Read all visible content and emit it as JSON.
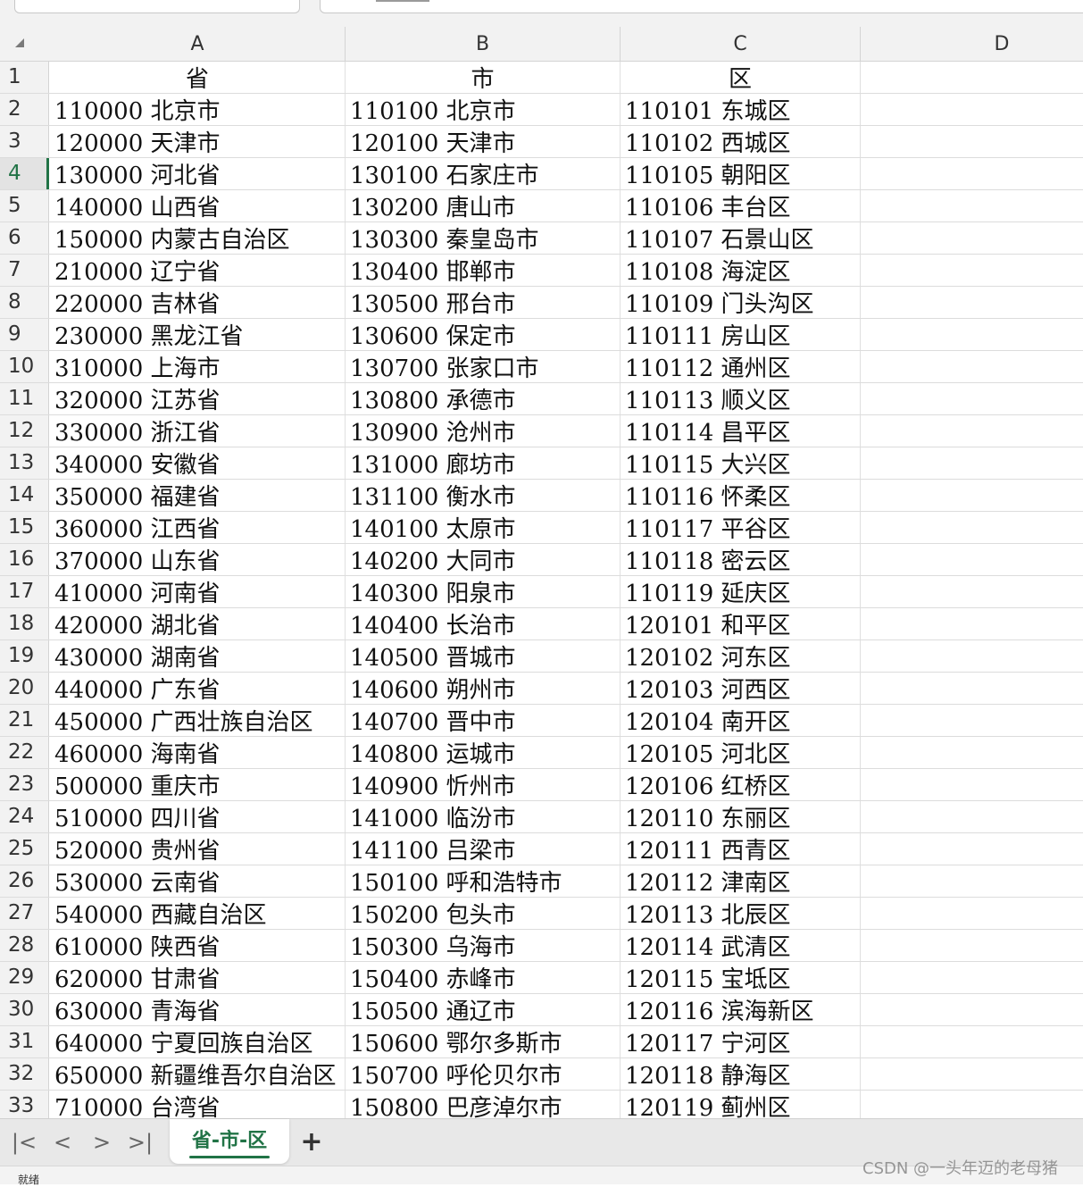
{
  "columns": [
    "A",
    "B",
    "C",
    "D"
  ],
  "rows": [
    {
      "n": "1",
      "a": "省",
      "b": "市",
      "c": "区",
      "d": ""
    },
    {
      "n": "2",
      "a": "110000 北京市",
      "b": "110100 北京市",
      "c": "110101 东城区",
      "d": ""
    },
    {
      "n": "3",
      "a": "120000 天津市",
      "b": "120100 天津市",
      "c": "110102 西城区",
      "d": ""
    },
    {
      "n": "4",
      "a": "130000 河北省",
      "b": "130100 石家庄市",
      "c": "110105 朝阳区",
      "d": ""
    },
    {
      "n": "5",
      "a": "140000 山西省",
      "b": "130200 唐山市",
      "c": "110106 丰台区",
      "d": ""
    },
    {
      "n": "6",
      "a": "150000 内蒙古自治区",
      "b": "130300 秦皇岛市",
      "c": "110107 石景山区",
      "d": ""
    },
    {
      "n": "7",
      "a": "210000 辽宁省",
      "b": "130400 邯郸市",
      "c": "110108 海淀区",
      "d": ""
    },
    {
      "n": "8",
      "a": "220000 吉林省",
      "b": "130500 邢台市",
      "c": "110109 门头沟区",
      "d": ""
    },
    {
      "n": "9",
      "a": "230000 黑龙江省",
      "b": "130600 保定市",
      "c": "110111 房山区",
      "d": ""
    },
    {
      "n": "10",
      "a": "310000 上海市",
      "b": "130700 张家口市",
      "c": "110112 通州区",
      "d": ""
    },
    {
      "n": "11",
      "a": "320000 江苏省",
      "b": "130800 承德市",
      "c": "110113 顺义区",
      "d": ""
    },
    {
      "n": "12",
      "a": "330000 浙江省",
      "b": "130900 沧州市",
      "c": "110114 昌平区",
      "d": ""
    },
    {
      "n": "13",
      "a": "340000 安徽省",
      "b": "131000 廊坊市",
      "c": "110115 大兴区",
      "d": ""
    },
    {
      "n": "14",
      "a": "350000 福建省",
      "b": "131100 衡水市",
      "c": "110116 怀柔区",
      "d": ""
    },
    {
      "n": "15",
      "a": "360000 江西省",
      "b": "140100 太原市",
      "c": "110117 平谷区",
      "d": ""
    },
    {
      "n": "16",
      "a": "370000 山东省",
      "b": "140200 大同市",
      "c": "110118 密云区",
      "d": ""
    },
    {
      "n": "17",
      "a": "410000 河南省",
      "b": "140300 阳泉市",
      "c": "110119 延庆区",
      "d": ""
    },
    {
      "n": "18",
      "a": "420000 湖北省",
      "b": "140400 长治市",
      "c": "120101 和平区",
      "d": ""
    },
    {
      "n": "19",
      "a": "430000 湖南省",
      "b": "140500 晋城市",
      "c": "120102 河东区",
      "d": ""
    },
    {
      "n": "20",
      "a": "440000 广东省",
      "b": "140600 朔州市",
      "c": "120103 河西区",
      "d": ""
    },
    {
      "n": "21",
      "a": "450000 广西壮族自治区",
      "b": "140700 晋中市",
      "c": "120104 南开区",
      "d": ""
    },
    {
      "n": "22",
      "a": "460000 海南省",
      "b": "140800 运城市",
      "c": "120105 河北区",
      "d": ""
    },
    {
      "n": "23",
      "a": "500000 重庆市",
      "b": "140900 忻州市",
      "c": "120106 红桥区",
      "d": ""
    },
    {
      "n": "24",
      "a": "510000 四川省",
      "b": "141000 临汾市",
      "c": "120110 东丽区",
      "d": ""
    },
    {
      "n": "25",
      "a": "520000 贵州省",
      "b": "141100 吕梁市",
      "c": "120111 西青区",
      "d": ""
    },
    {
      "n": "26",
      "a": "530000 云南省",
      "b": "150100 呼和浩特市",
      "c": "120112 津南区",
      "d": ""
    },
    {
      "n": "27",
      "a": "540000 西藏自治区",
      "b": "150200 包头市",
      "c": "120113 北辰区",
      "d": ""
    },
    {
      "n": "28",
      "a": "610000 陕西省",
      "b": "150300 乌海市",
      "c": "120114 武清区",
      "d": ""
    },
    {
      "n": "29",
      "a": "620000 甘肃省",
      "b": "150400 赤峰市",
      "c": "120115 宝坻区",
      "d": ""
    },
    {
      "n": "30",
      "a": "630000 青海省",
      "b": "150500 通辽市",
      "c": "120116 滨海新区",
      "d": ""
    },
    {
      "n": "31",
      "a": "640000 宁夏回族自治区",
      "b": "150600 鄂尔多斯市",
      "c": "120117 宁河区",
      "d": ""
    },
    {
      "n": "32",
      "a": "650000 新疆维吾尔自治区",
      "b": "150700 呼伦贝尔市",
      "c": "120118 静海区",
      "d": ""
    },
    {
      "n": "33",
      "a": "710000 台湾省",
      "b": "150800 巴彦淖尔市",
      "c": "120119 蓟州区",
      "d": ""
    }
  ],
  "active_row": "4",
  "tabs": {
    "nav_first": "|<",
    "nav_prev": "<",
    "nav_next": ">",
    "nav_last": ">|",
    "sheet_name": "省-市-区",
    "add_sheet": "+"
  },
  "status": {
    "text": "就绪"
  },
  "watermark": "CSDN @一头年迈的老母猪",
  "colors": {
    "accent": "#217346"
  }
}
